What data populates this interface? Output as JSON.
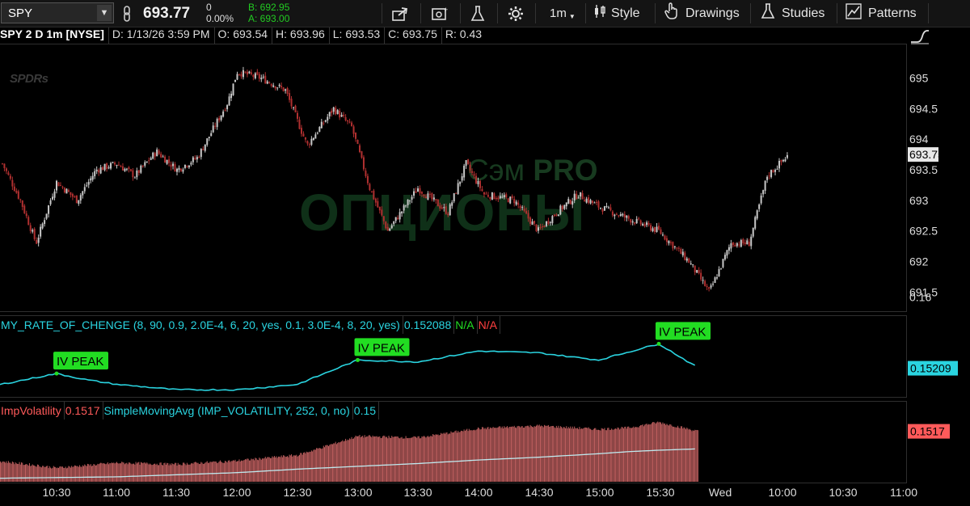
{
  "toolbar": {
    "symbol": "SPY",
    "price": "693.77",
    "change": "0",
    "change_pct": "0.00%",
    "bid": "B: 692.95",
    "ask": "A: 693.00",
    "timeframe": "1m",
    "style_label": "Style",
    "drawings_label": "Drawings",
    "studies_label": "Studies",
    "patterns_label": "Patterns"
  },
  "info": {
    "title": "SPY 2 D 1m [NYSE]",
    "date": "D: 1/13/26 3:59 PM",
    "open": "O: 693.54",
    "high": "H: 693.96",
    "low": "L: 693.53",
    "close": "C: 693.75",
    "range": "R: 0.43",
    "logo": "SPDRs"
  },
  "watermark": {
    "line1": "Сэм ",
    "line1_bold": "PRO",
    "line2": "ОПЦИОНЫ"
  },
  "studies": {
    "roc_label": "MY_RATE_OF_CHENGE (8, 90, 0.9, 2.0E-4, 6, 20, yes, 0.1, 3.0E-4, 8, 20, yes)",
    "roc_value": "0.152088",
    "roc_na1": "N/A",
    "roc_na2": "N/A",
    "iv_label": "ImpVolatility",
    "iv_value": "0.1517",
    "sma_label": "SimpleMovingAvg (IMP_VOLATILITY, 252, 0, no)",
    "sma_value": "0.15"
  },
  "colors": {
    "bg": "#000000",
    "up": "#c8c8c8",
    "down": "#b03030",
    "cyan": "#2ad4e0",
    "green": "#22dd22",
    "red_label": "#ff5a5a",
    "price_tag": "#e8e8e8"
  },
  "chart_data": [
    {
      "type": "candlestick",
      "title": "SPY 2 D 1m [NYSE]",
      "x_ticks": [
        "10:30",
        "11:00",
        "11:30",
        "12:00",
        "12:30",
        "13:00",
        "13:30",
        "14:00",
        "14:30",
        "15:00",
        "15:30",
        "Wed",
        "10:00",
        "10:30",
        "11:00"
      ],
      "y_ticks": [
        "691.5",
        "692",
        "692.5",
        "693",
        "693.5",
        "694",
        "694.5",
        "695"
      ],
      "ylim": [
        691.2,
        695.55
      ],
      "last_price": "693.75",
      "path": [
        [
          10.05,
          693.6
        ],
        [
          10.2,
          693.0
        ],
        [
          10.33,
          692.3
        ],
        [
          10.5,
          693.3
        ],
        [
          10.67,
          693.0
        ],
        [
          10.83,
          693.5
        ],
        [
          11.0,
          693.6
        ],
        [
          11.15,
          693.4
        ],
        [
          11.33,
          693.8
        ],
        [
          11.5,
          693.5
        ],
        [
          11.67,
          693.7
        ],
        [
          11.92,
          694.6
        ],
        [
          12.0,
          695.1
        ],
        [
          12.2,
          695.0
        ],
        [
          12.4,
          694.8
        ],
        [
          12.58,
          693.9
        ],
        [
          12.8,
          694.5
        ],
        [
          12.95,
          694.2
        ],
        [
          13.1,
          693.2
        ],
        [
          13.25,
          692.5
        ],
        [
          13.5,
          693.2
        ],
        [
          13.75,
          692.8
        ],
        [
          13.9,
          693.6
        ],
        [
          14.05,
          693.1
        ],
        [
          14.3,
          693.0
        ],
        [
          14.5,
          692.5
        ],
        [
          14.65,
          692.8
        ],
        [
          14.83,
          693.1
        ],
        [
          15.0,
          692.9
        ],
        [
          15.25,
          692.7
        ],
        [
          15.5,
          692.5
        ],
        [
          15.75,
          692.0
        ],
        [
          15.92,
          691.5
        ],
        [
          16.1,
          692.3
        ],
        [
          16.25,
          692.3
        ],
        [
          16.4,
          693.4
        ],
        [
          16.58,
          693.75
        ]
      ]
    },
    {
      "type": "line",
      "name": "MY_RATE_OF_CHENGE",
      "y_ticks": [
        "0.16"
      ],
      "last_value": "0.15209",
      "annotations": [
        "IV PEAK",
        "IV PEAK",
        "IV PEAK"
      ],
      "x": [
        10.0,
        10.5,
        10.75,
        11.0,
        11.5,
        12.0,
        12.5,
        13.0,
        13.5,
        14.0,
        14.5,
        15.0,
        15.5,
        15.83
      ],
      "values": [
        0.1502,
        0.1515,
        0.1508,
        0.1503,
        0.1497,
        0.1497,
        0.1503,
        0.153,
        0.1528,
        0.154,
        0.1538,
        0.153,
        0.1548,
        0.1521
      ]
    },
    {
      "type": "bar",
      "name": "ImpVolatility",
      "last_value": "0.1517",
      "sma_value": "0.15",
      "x": [
        10.0,
        10.5,
        11.0,
        11.5,
        12.0,
        12.5,
        13.0,
        13.5,
        14.0,
        14.5,
        15.0,
        15.25,
        15.5,
        15.83
      ],
      "values": [
        0.1475,
        0.1465,
        0.1472,
        0.147,
        0.1475,
        0.1483,
        0.151,
        0.1508,
        0.1521,
        0.1525,
        0.152,
        0.1522,
        0.153,
        0.1517
      ],
      "sma": [
        0.145,
        0.1451,
        0.1452,
        0.1455,
        0.1458,
        0.1463,
        0.1467,
        0.1471,
        0.1476,
        0.148,
        0.1485,
        0.1488,
        0.149,
        0.1492
      ]
    }
  ]
}
